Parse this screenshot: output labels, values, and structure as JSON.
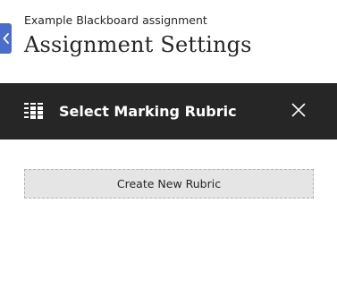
{
  "header": {
    "course_name": "Example Blackboard assignment",
    "page_title": "Assignment Settings",
    "back_icon": "chevron-left-icon",
    "accent_color": "#4b6cc9"
  },
  "panel": {
    "title": "Select Marking Rubric",
    "icon": "rubric-grid-icon",
    "close_icon": "close-icon",
    "background_color": "#262626"
  },
  "actions": {
    "create_rubric_label": "Create New Rubric"
  }
}
